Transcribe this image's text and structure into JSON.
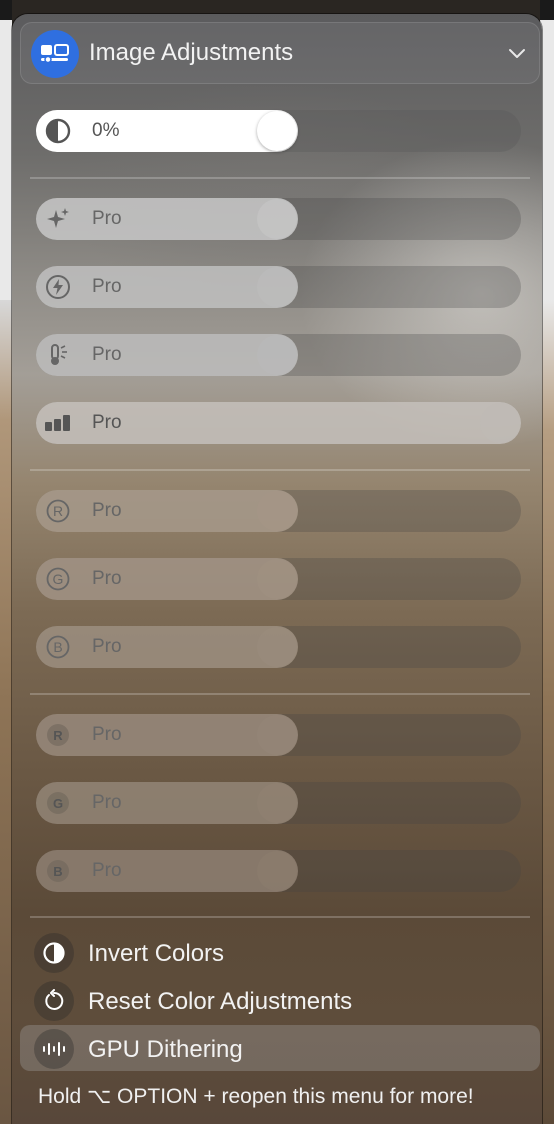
{
  "header": {
    "title": "Image Adjustments",
    "icon": "display-settings-icon",
    "toggle_icon": "chevron-down-icon",
    "accent": "#2f6fe0"
  },
  "brightness": {
    "value_label": "0%",
    "icon": "contrast-icon",
    "level": 0.0
  },
  "groups": [
    {
      "sliders": [
        {
          "icon": "sparkle-icon",
          "label": "Pro",
          "level": 0.0
        },
        {
          "icon": "lightning-icon",
          "label": "Pro",
          "level": 0.0
        },
        {
          "icon": "thermometer-icon",
          "label": "Pro",
          "level": 0.0
        },
        {
          "icon": "bars-icon",
          "label": "Pro",
          "level": 1.0
        }
      ]
    },
    {
      "sliders": [
        {
          "icon": "circle-letter-r-icon",
          "letter": "R",
          "label": "Pro",
          "level": 0.0
        },
        {
          "icon": "circle-letter-g-icon",
          "letter": "G",
          "label": "Pro",
          "level": 0.0
        },
        {
          "icon": "circle-letter-b-icon",
          "letter": "B",
          "label": "Pro",
          "level": 0.0
        }
      ]
    },
    {
      "sliders": [
        {
          "icon": "filled-letter-r-icon",
          "letter": "R",
          "label": "Pro",
          "level": 0.0
        },
        {
          "icon": "filled-letter-g-icon",
          "letter": "G",
          "label": "Pro",
          "level": 0.0
        },
        {
          "icon": "filled-letter-b-icon",
          "letter": "B",
          "label": "Pro",
          "level": 0.0
        }
      ]
    }
  ],
  "menu": [
    {
      "label": "Invert Colors",
      "icon": "invert-icon",
      "active": false
    },
    {
      "label": "Reset Color Adjustments",
      "icon": "reset-icon",
      "active": false
    },
    {
      "label": "GPU Dithering",
      "icon": "waveform-icon",
      "active": true
    }
  ],
  "footer": "Hold ⌥ OPTION + reopen this menu for more!"
}
